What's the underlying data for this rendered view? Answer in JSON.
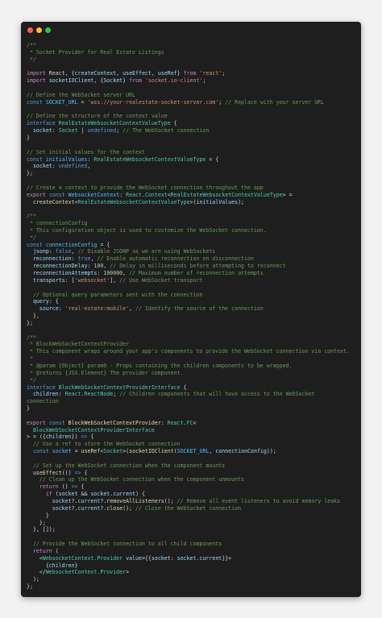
{
  "window": {
    "buttons": [
      "close",
      "minimize",
      "maximize"
    ]
  },
  "code_lines": [
    [
      [
        "c",
        "/**"
      ]
    ],
    [
      [
        "c",
        " * Socket Provider for Real Estate Listings"
      ]
    ],
    [
      [
        "c",
        " */"
      ]
    ],
    [],
    [
      [
        "p",
        "import"
      ],
      [
        "x",
        " React, {"
      ],
      [
        "v",
        "createContext"
      ],
      [
        "x",
        ", "
      ],
      [
        "v",
        "useEffect"
      ],
      [
        "x",
        ", "
      ],
      [
        "v",
        "useRef"
      ],
      [
        "x",
        "} "
      ],
      [
        "p",
        "from"
      ],
      [
        "x",
        " "
      ],
      [
        "s",
        "'react'"
      ],
      [
        "x",
        ";"
      ]
    ],
    [
      [
        "p",
        "import"
      ],
      [
        "x",
        " "
      ],
      [
        "v",
        "socketIOClient"
      ],
      [
        "x",
        ", {"
      ],
      [
        "v",
        "Socket"
      ],
      [
        "x",
        "} "
      ],
      [
        "p",
        "from"
      ],
      [
        "x",
        " "
      ],
      [
        "s",
        "'socket.io-client'"
      ],
      [
        "x",
        ";"
      ]
    ],
    [],
    [
      [
        "c",
        "// Define the WebSocket server URL"
      ]
    ],
    [
      [
        "k",
        "const"
      ],
      [
        "x",
        " "
      ],
      [
        "cc",
        "SOCKET_URL"
      ],
      [
        "x",
        " = "
      ],
      [
        "s",
        "'wss://your-realestate-socket-server.com'"
      ],
      [
        "x",
        "; "
      ],
      [
        "c",
        "// Replace with your server URL"
      ]
    ],
    [],
    [
      [
        "c",
        "// Define the structure of the context value"
      ]
    ],
    [
      [
        "k",
        "interface"
      ],
      [
        "x",
        " "
      ],
      [
        "t",
        "RealEstateWebsocketContextValueType"
      ],
      [
        "x",
        " {"
      ]
    ],
    [
      [
        "x",
        "  "
      ],
      [
        "v",
        "socket"
      ],
      [
        "x",
        ": "
      ],
      [
        "t",
        "Socket"
      ],
      [
        "x",
        " | "
      ],
      [
        "k",
        "undefined"
      ],
      [
        "x",
        "; "
      ],
      [
        "c",
        "// The WebSocket connection"
      ]
    ],
    [
      [
        "x",
        "}"
      ]
    ],
    [],
    [
      [
        "c",
        "// Set initial values for the context"
      ]
    ],
    [
      [
        "k",
        "const"
      ],
      [
        "x",
        " "
      ],
      [
        "cc",
        "initialValues"
      ],
      [
        "x",
        ": "
      ],
      [
        "t",
        "RealEstateWebsocketContextValueType"
      ],
      [
        "x",
        " = {"
      ]
    ],
    [
      [
        "x",
        "  "
      ],
      [
        "v",
        "socket"
      ],
      [
        "x",
        ": "
      ],
      [
        "k",
        "undefined"
      ],
      [
        "x",
        ","
      ]
    ],
    [
      [
        "x",
        "};"
      ]
    ],
    [],
    [
      [
        "c",
        "// Create a context to provide the WebSocket connection throughout the app"
      ]
    ],
    [
      [
        "p",
        "export"
      ],
      [
        "x",
        " "
      ],
      [
        "k",
        "const"
      ],
      [
        "x",
        " "
      ],
      [
        "cc",
        "WebsocketContext"
      ],
      [
        "x",
        ": "
      ],
      [
        "t",
        "React"
      ],
      [
        "x",
        "."
      ],
      [
        "t",
        "Context"
      ],
      [
        "x",
        "<"
      ],
      [
        "t",
        "RealEstateWebsocketContextValueType"
      ],
      [
        "x",
        "> ="
      ]
    ],
    [
      [
        "x",
        "  "
      ],
      [
        "f",
        "createContext"
      ],
      [
        "x",
        "<"
      ],
      [
        "t",
        "RealEstateWebsocketContextValueType"
      ],
      [
        "x",
        ">("
      ],
      [
        "v",
        "initialValues"
      ],
      [
        "x",
        ");"
      ]
    ],
    [],
    [
      [
        "c",
        "/**"
      ]
    ],
    [
      [
        "c",
        " * connectionConfig"
      ]
    ],
    [
      [
        "c",
        " * This configuration object is used to customize the WebSocket connection."
      ]
    ],
    [
      [
        "c",
        " */"
      ]
    ],
    [
      [
        "k",
        "const"
      ],
      [
        "x",
        " "
      ],
      [
        "cc",
        "connectionConfig"
      ],
      [
        "x",
        " = {"
      ]
    ],
    [
      [
        "x",
        "  "
      ],
      [
        "v",
        "jsonp"
      ],
      [
        "x",
        ": "
      ],
      [
        "k",
        "false"
      ],
      [
        "x",
        ", "
      ],
      [
        "c",
        "// Disable JSONP as we are using WebSockets"
      ]
    ],
    [
      [
        "x",
        "  "
      ],
      [
        "v",
        "reconnection"
      ],
      [
        "x",
        ": "
      ],
      [
        "k",
        "true"
      ],
      [
        "x",
        ", "
      ],
      [
        "c",
        "// Enable automatic reconnection on disconnection"
      ]
    ],
    [
      [
        "x",
        "  "
      ],
      [
        "v",
        "reconnectionDelay"
      ],
      [
        "x",
        ": "
      ],
      [
        "n",
        "100"
      ],
      [
        "x",
        ", "
      ],
      [
        "c",
        "// Delay in milliseconds before attempting to reconnect"
      ]
    ],
    [
      [
        "x",
        "  "
      ],
      [
        "v",
        "reconnectionAttempts"
      ],
      [
        "x",
        ": "
      ],
      [
        "n",
        "100000"
      ],
      [
        "x",
        ", "
      ],
      [
        "c",
        "// Maximum number of reconnection attempts"
      ]
    ],
    [
      [
        "x",
        "  "
      ],
      [
        "v",
        "transports"
      ],
      [
        "x",
        ": ["
      ],
      [
        "s",
        "'websocket'"
      ],
      [
        "x",
        "], "
      ],
      [
        "c",
        "// Use WebSocket transport"
      ]
    ],
    [],
    [
      [
        "x",
        "  "
      ],
      [
        "c",
        "// Optional query parameters sent with the connection"
      ]
    ],
    [
      [
        "x",
        "  "
      ],
      [
        "v",
        "query"
      ],
      [
        "x",
        ": {"
      ]
    ],
    [
      [
        "x",
        "    "
      ],
      [
        "v",
        "source"
      ],
      [
        "x",
        ": "
      ],
      [
        "s",
        "'real-estate:mobile'"
      ],
      [
        "x",
        ", "
      ],
      [
        "c",
        "// Identify the source of the connection"
      ]
    ],
    [
      [
        "x",
        "  },"
      ]
    ],
    [
      [
        "x",
        "};"
      ]
    ],
    [],
    [
      [
        "c",
        "/**"
      ]
    ],
    [
      [
        "c",
        " * BlockWebSocketContextProvider"
      ]
    ],
    [
      [
        "c",
        " * This component wraps around your app's components to provide the WebSocket connection via context."
      ]
    ],
    [
      [
        "c",
        " *"
      ]
    ],
    [
      [
        "c",
        " * @param {Object} param0 - Props containing the children components to be wrapped."
      ]
    ],
    [
      [
        "c",
        " * @returns {JSX.Element} The provider component."
      ]
    ],
    [
      [
        "c",
        " */"
      ]
    ],
    [
      [
        "k",
        "interface"
      ],
      [
        "x",
        " "
      ],
      [
        "t",
        "BlockWebSocketContextProviderInterface"
      ],
      [
        "x",
        " {"
      ]
    ],
    [
      [
        "x",
        "  "
      ],
      [
        "v",
        "children"
      ],
      [
        "x",
        ": "
      ],
      [
        "t",
        "React"
      ],
      [
        "x",
        "."
      ],
      [
        "t",
        "ReactNode"
      ],
      [
        "x",
        "; "
      ],
      [
        "c",
        "// Children components that will have access to the WebSocket"
      ]
    ],
    [
      [
        "c",
        "connection"
      ]
    ],
    [
      [
        "x",
        "}"
      ]
    ],
    [],
    [
      [
        "p",
        "export"
      ],
      [
        "x",
        " "
      ],
      [
        "k",
        "const"
      ],
      [
        "x",
        " "
      ],
      [
        "f",
        "BlockWebSocketContextProvider"
      ],
      [
        "x",
        ": "
      ],
      [
        "t",
        "React"
      ],
      [
        "x",
        "."
      ],
      [
        "t",
        "FC"
      ],
      [
        "x",
        "<"
      ]
    ],
    [
      [
        "x",
        "  "
      ],
      [
        "t",
        "BlockWebSocketContextProviderInterface"
      ]
    ],
    [
      [
        "x",
        "> = ({"
      ],
      [
        "v",
        "children"
      ],
      [
        "x",
        "}) "
      ],
      [
        "k",
        "=>"
      ],
      [
        "x",
        " {"
      ]
    ],
    [
      [
        "x",
        "  "
      ],
      [
        "c",
        "// Use a ref to store the WebSocket connection"
      ]
    ],
    [
      [
        "x",
        "  "
      ],
      [
        "k",
        "const"
      ],
      [
        "x",
        " "
      ],
      [
        "cc",
        "socket"
      ],
      [
        "x",
        " = "
      ],
      [
        "f",
        "useRef"
      ],
      [
        "x",
        "<"
      ],
      [
        "t",
        "Socket"
      ],
      [
        "x",
        ">("
      ],
      [
        "f",
        "socketIOClient"
      ],
      [
        "x",
        "("
      ],
      [
        "cc",
        "SOCKET_URL"
      ],
      [
        "x",
        ", "
      ],
      [
        "v",
        "connectionConfig"
      ],
      [
        "x",
        "));"
      ]
    ],
    [],
    [
      [
        "x",
        "  "
      ],
      [
        "c",
        "// Set up the WebSocket connection when the component mounts"
      ]
    ],
    [
      [
        "x",
        "  "
      ],
      [
        "f",
        "useEffect"
      ],
      [
        "x",
        "(() "
      ],
      [
        "k",
        "=>"
      ],
      [
        "x",
        " {"
      ]
    ],
    [
      [
        "x",
        "    "
      ],
      [
        "c",
        "// Clean up the WebSocket connection when the component unmounts"
      ]
    ],
    [
      [
        "x",
        "    "
      ],
      [
        "p",
        "return"
      ],
      [
        "x",
        " () "
      ],
      [
        "k",
        "=>"
      ],
      [
        "x",
        " {"
      ]
    ],
    [
      [
        "x",
        "      "
      ],
      [
        "p",
        "if"
      ],
      [
        "x",
        " ("
      ],
      [
        "v",
        "socket"
      ],
      [
        "x",
        " && "
      ],
      [
        "v",
        "socket"
      ],
      [
        "x",
        "."
      ],
      [
        "v",
        "current"
      ],
      [
        "x",
        ") {"
      ]
    ],
    [
      [
        "x",
        "        "
      ],
      [
        "v",
        "socket"
      ],
      [
        "x",
        "?."
      ],
      [
        "v",
        "current"
      ],
      [
        "x",
        "?."
      ],
      [
        "f",
        "removeAllListeners"
      ],
      [
        "x",
        "(); "
      ],
      [
        "c",
        "// Remove all event listeners to avoid memory leaks"
      ]
    ],
    [
      [
        "x",
        "        "
      ],
      [
        "v",
        "socket"
      ],
      [
        "x",
        "?."
      ],
      [
        "v",
        "current"
      ],
      [
        "x",
        "?."
      ],
      [
        "f",
        "close"
      ],
      [
        "x",
        "(); "
      ],
      [
        "c",
        "// Close the WebSocket connection"
      ]
    ],
    [
      [
        "x",
        "      }"
      ]
    ],
    [
      [
        "x",
        "    };"
      ]
    ],
    [
      [
        "x",
        "  }, []);"
      ]
    ],
    [],
    [
      [
        "x",
        "  "
      ],
      [
        "c",
        "// Provide the WebSocket connection to all child components"
      ]
    ],
    [
      [
        "x",
        "  "
      ],
      [
        "p",
        "return"
      ],
      [
        "x",
        " ("
      ]
    ],
    [
      [
        "x",
        "    <"
      ],
      [
        "t",
        "WebsocketContext.Provider"
      ],
      [
        "x",
        " "
      ],
      [
        "v",
        "value"
      ],
      [
        "x",
        "={{"
      ],
      [
        "v",
        "socket"
      ],
      [
        "x",
        ": "
      ],
      [
        "v",
        "socket"
      ],
      [
        "x",
        "."
      ],
      [
        "v",
        "current"
      ],
      [
        "x",
        "}}>"
      ]
    ],
    [
      [
        "x",
        "      {"
      ],
      [
        "v",
        "children"
      ],
      [
        "x",
        "}"
      ]
    ],
    [
      [
        "x",
        "    </"
      ],
      [
        "t",
        "WebsocketContext.Provider"
      ],
      [
        "x",
        ">"
      ]
    ],
    [
      [
        "x",
        "  );"
      ]
    ],
    [
      [
        "x",
        "};"
      ]
    ]
  ]
}
